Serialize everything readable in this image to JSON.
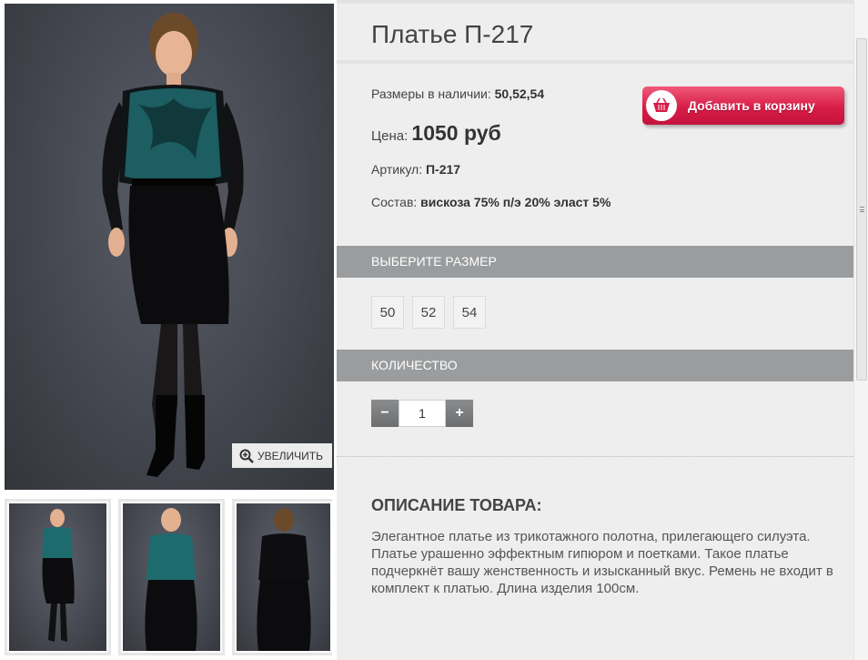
{
  "product": {
    "title": "Платье П-217",
    "sizes_label": "Размеры в наличии:",
    "sizes_value": "50,52,54",
    "price_label": "Цена:",
    "price_value": "1050 руб",
    "sku_label": "Артикул:",
    "sku_value": "П-217",
    "composition_label": "Состав:",
    "composition_value": "вискоза 75% п/э 20% эласт 5%"
  },
  "cart_button": {
    "label": "Добавить в корзину",
    "icon": "basket-icon"
  },
  "zoom": {
    "label": "УВЕЛИЧИТЬ",
    "icon": "zoom-in-icon"
  },
  "size_section": {
    "title": "ВЫБЕРИТЕ РАЗМЕР",
    "options": [
      "50",
      "52",
      "54"
    ]
  },
  "quantity_section": {
    "title": "КОЛИЧЕСТВО",
    "value": "1",
    "minus": "−",
    "plus": "+"
  },
  "description": {
    "title": "ОПИСАНИЕ ТОВАРА:",
    "text": "Элегантное платье из трикотажного полотна, прилегающего силуэта. Платье урашенно эффектным гипюром и поетками. Такое платье подчеркнёт вашу женственность и изысканный вкус. Ремень не входит в комплект к платью. Длина изделия 100см."
  },
  "colors": {
    "accent": "#d81c48",
    "section_bar": "#9a9c9e",
    "panel_bg": "#eeeeee",
    "dress_pattern": "#1e6b6e"
  }
}
